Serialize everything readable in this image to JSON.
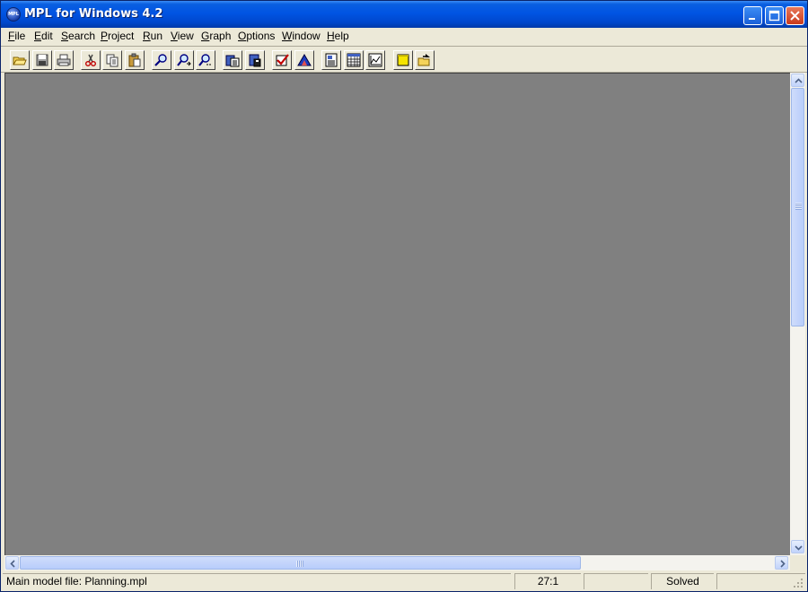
{
  "window": {
    "title": "MPL for Windows 4.2",
    "app_icon_text": "MPL"
  },
  "menu": [
    {
      "label": "File",
      "key": "F"
    },
    {
      "label": "Edit",
      "key": "E"
    },
    {
      "label": "Search",
      "key": "S"
    },
    {
      "label": "Project",
      "key": "P"
    },
    {
      "label": "Run",
      "key": "R"
    },
    {
      "label": "View",
      "key": "V"
    },
    {
      "label": "Graph",
      "key": "G"
    },
    {
      "label": "Options",
      "key": "O"
    },
    {
      "label": "Window",
      "key": "W"
    },
    {
      "label": "Help",
      "key": "H"
    }
  ],
  "toolbar": {
    "buttons": [
      "open-icon",
      "save-icon",
      "print-icon",
      "cut-icon",
      "copy-icon",
      "paste-icon",
      "find-icon",
      "find-next-icon",
      "replace-icon",
      "solve-icon",
      "save-solution-icon",
      "check-syntax-icon",
      "graph-icon",
      "view-solution-icon",
      "matrix-icon",
      "chart-icon",
      "note-icon",
      "export-icon"
    ]
  },
  "status": {
    "main_file": "Main model file: Planning.mpl",
    "position": "27:1",
    "empty": "",
    "state": "Solved"
  },
  "colors": {
    "titlebar": "#0054e3",
    "client": "#808080",
    "chrome": "#ece9d8"
  }
}
